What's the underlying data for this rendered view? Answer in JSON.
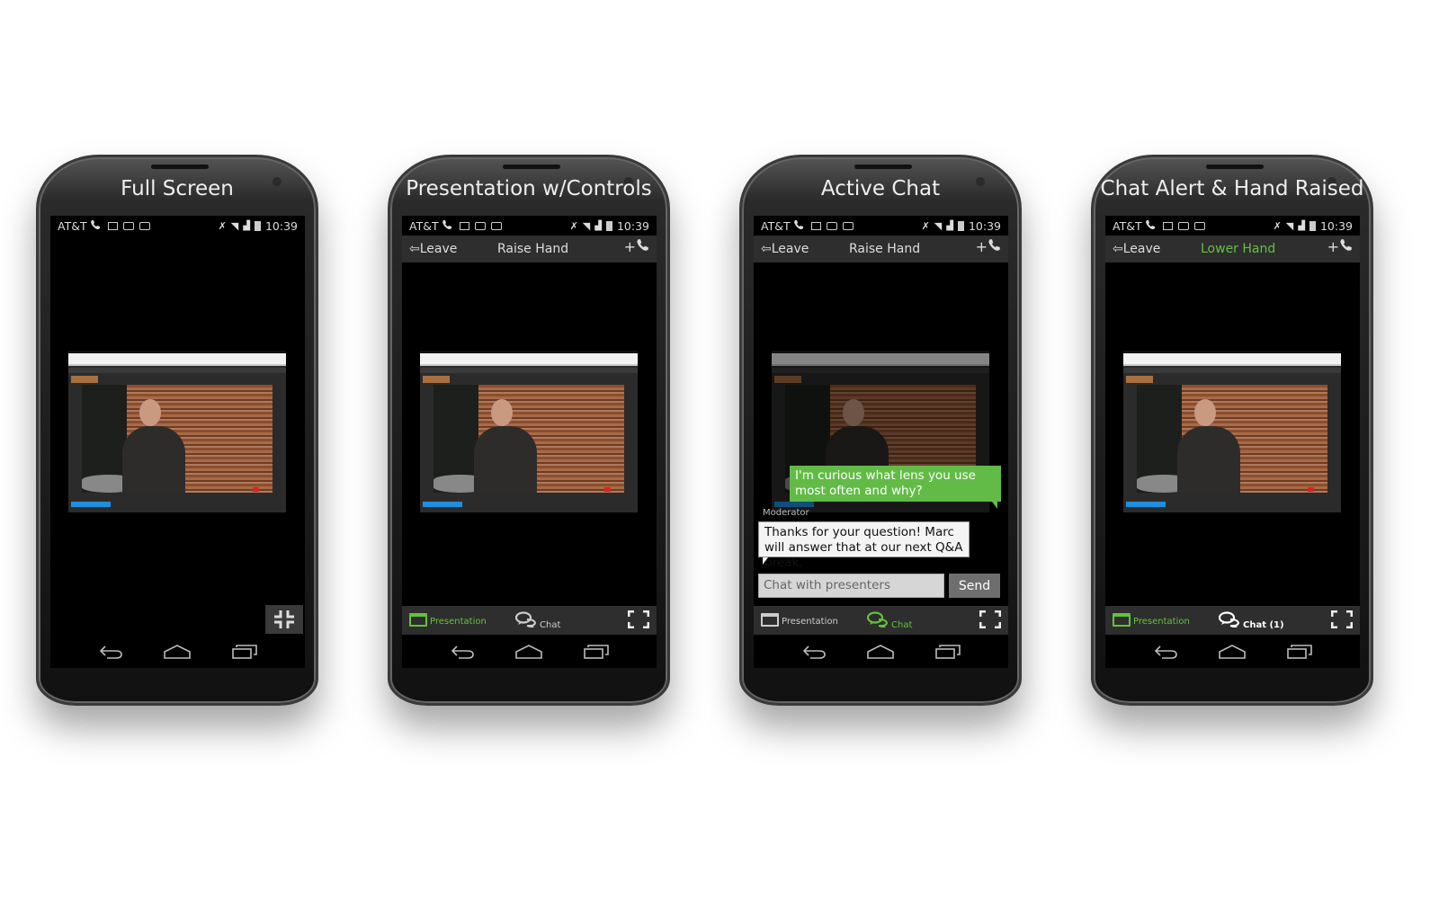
{
  "accent_green": "#63c23c",
  "status": {
    "carrier": "AT&T",
    "time": "10:39"
  },
  "labels": {
    "leave": "Leave",
    "add_call": "+",
    "presentation": "Presentation",
    "moderator": "Moderator",
    "send": "Send",
    "chat_placeholder": "Chat with presenters"
  },
  "phones": [
    {
      "title": "Full Screen",
      "mode": "fullscreen"
    },
    {
      "title": "Presentation w/Controls",
      "mode": "controls",
      "hand_label": "Raise Hand",
      "hand_active": false,
      "active_tab": "presentation",
      "chat_label": "Chat"
    },
    {
      "title": "Active Chat",
      "mode": "chat",
      "hand_label": "Raise Hand",
      "hand_active": false,
      "active_tab": "chat",
      "chat_label": "Chat",
      "messages": {
        "user": "I'm curious what lens you use most often and why?",
        "moderator": "Thanks for your question! Marc will answer that at our next Q&A break."
      }
    },
    {
      "title": "Chat Alert & Hand Raised",
      "mode": "controls",
      "hand_label": "Lower Hand",
      "hand_active": true,
      "active_tab": "presentation",
      "chat_label": "Chat (1)",
      "chat_alert": true
    }
  ]
}
